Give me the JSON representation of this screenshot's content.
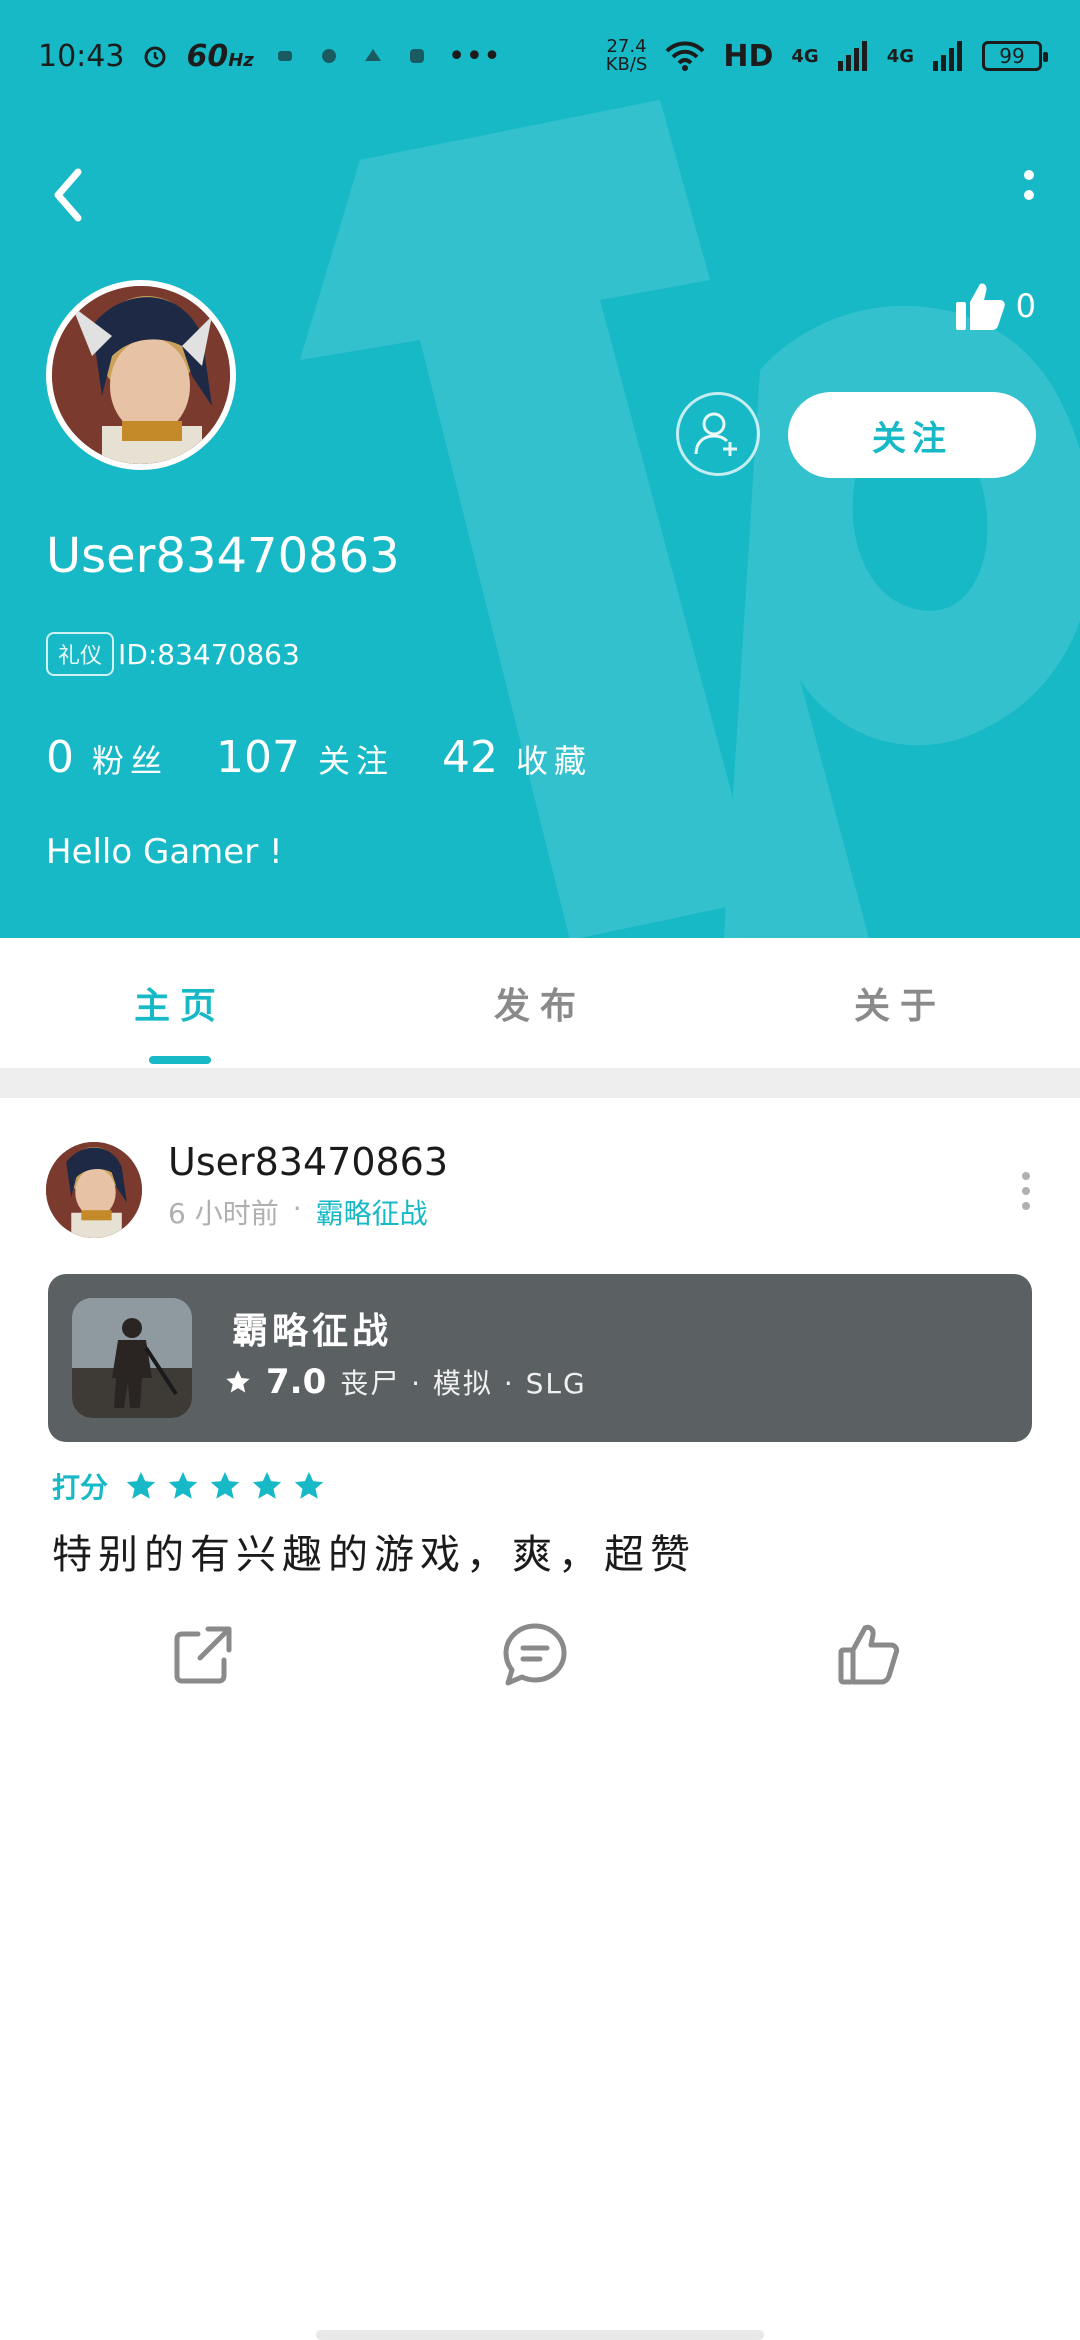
{
  "status_bar": {
    "time": "10:43",
    "refresh_rate": "60",
    "refresh_unit": "Hz",
    "more": "•••",
    "net_speed_value": "27.4",
    "net_speed_unit": "KB/S",
    "hd": "HD",
    "network": "4G",
    "battery": "99"
  },
  "profile": {
    "likes": "0",
    "follow_label": "关注",
    "username": "User83470863",
    "badge": "礼仪",
    "id_text": "ID:83470863",
    "stats": [
      {
        "num": "0",
        "label": "粉丝"
      },
      {
        "num": "107",
        "label": "关注"
      },
      {
        "num": "42",
        "label": "收藏"
      }
    ],
    "bio": "Hello Gamer !"
  },
  "tabs": [
    {
      "label": "主页",
      "active": true
    },
    {
      "label": "发布",
      "active": false
    },
    {
      "label": "关于",
      "active": false
    }
  ],
  "post": {
    "username": "User83470863",
    "time_ago": "6 小时前",
    "separator": "·",
    "game_link": "霸略征战",
    "game": {
      "title": "霸略征战",
      "score": "7.0",
      "tags": "丧尸 · 模拟 · SLG"
    },
    "rating_label": "打分",
    "stars": 5,
    "review": "特别的有兴趣的游戏，爽，超赞"
  },
  "colors": {
    "accent": "#17b9c7",
    "card": "#5b6062"
  },
  "icons": [
    "back-arrow-icon",
    "more-vertical-icon",
    "thumbs-up-icon",
    "add-user-icon",
    "star-icon",
    "share-icon",
    "comment-icon",
    "like-icon"
  ]
}
